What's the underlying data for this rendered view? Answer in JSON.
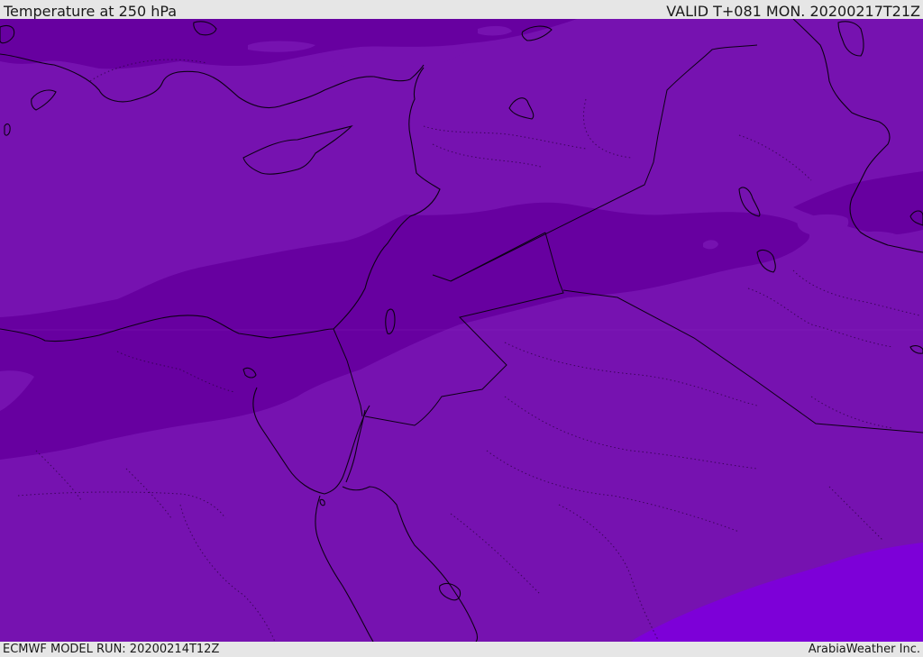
{
  "header": {
    "title": "Temperature at 250 hPa",
    "valid": "VALID T+081 MON. 20200217T21Z"
  },
  "footer": {
    "model_run": "ECMWF MODEL RUN: 20200214T12Z",
    "credit": "ArabiaWeather Inc."
  },
  "colors": {
    "band_main": "#7612b0",
    "band_cold": "#6700a0",
    "band_warm": "#7d00d8",
    "coastline": "#0d0015",
    "frame": "#e6e6e6"
  }
}
